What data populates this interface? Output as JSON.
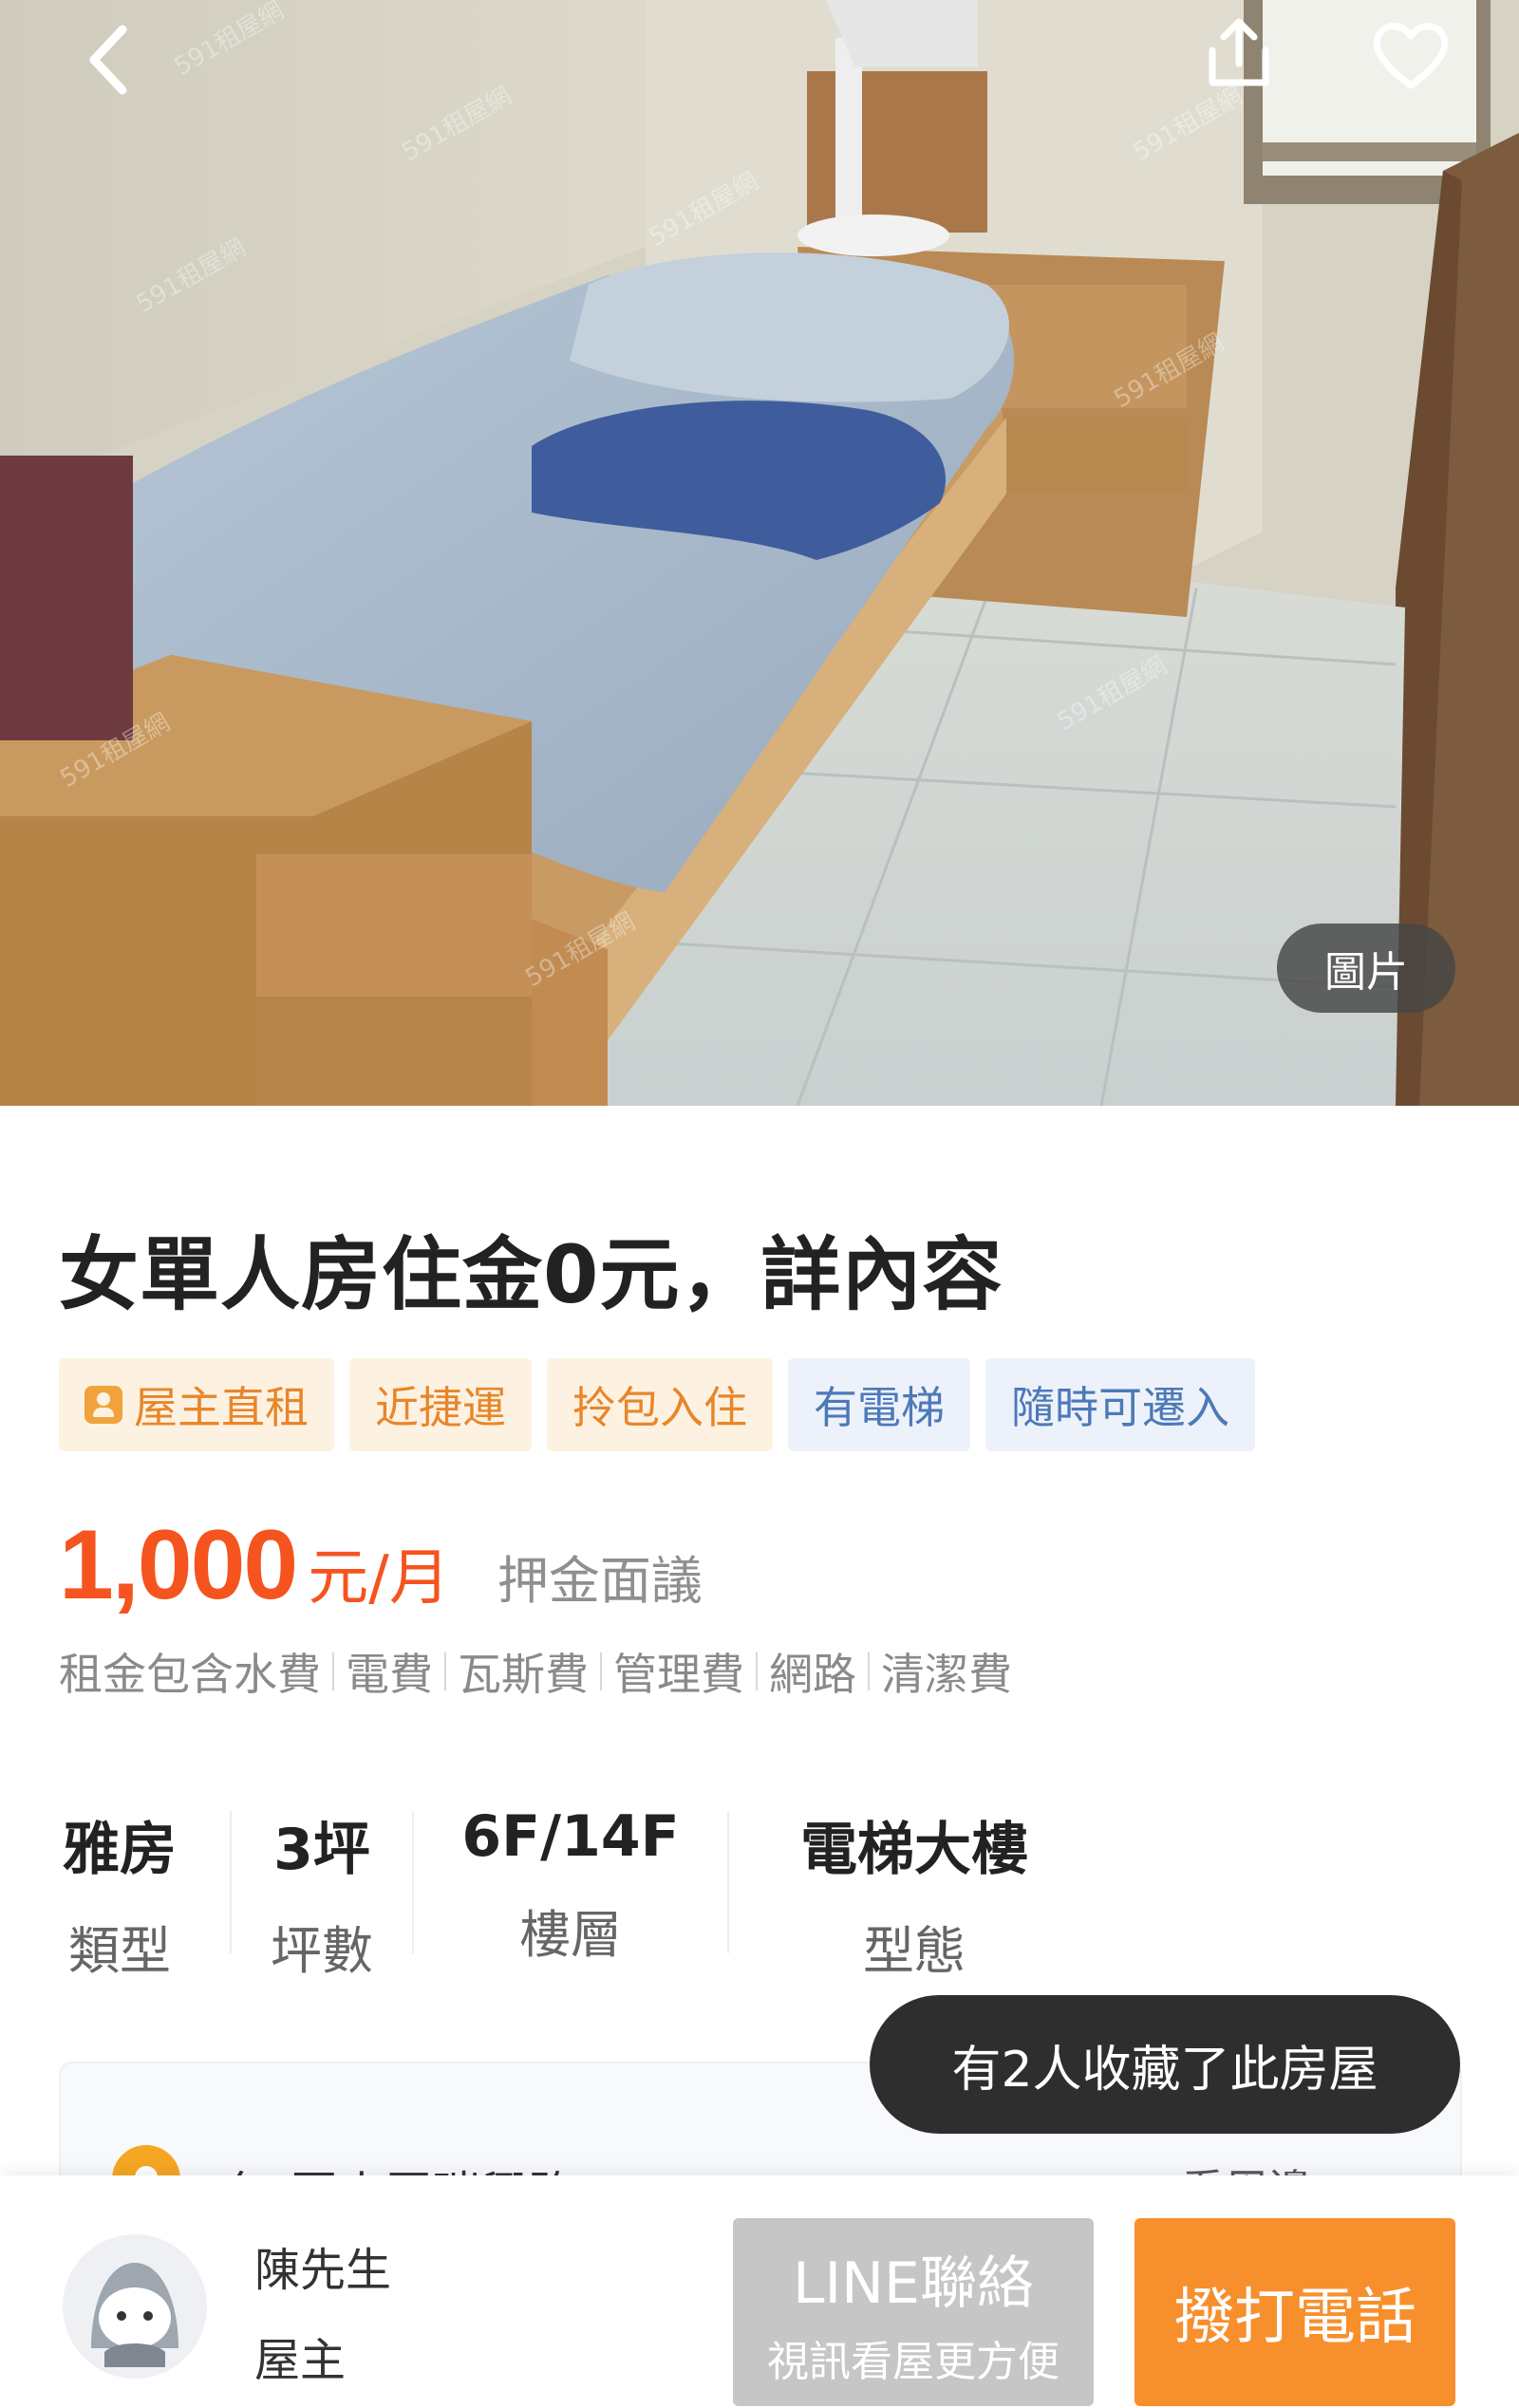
{
  "photo": {
    "badge_label": "圖片",
    "watermark": "591租屋網"
  },
  "header": {
    "back_icon": "chevron-left-icon",
    "share_icon": "share-icon",
    "favorite_icon": "heart-outline-icon"
  },
  "listing": {
    "title": "女單人房住金0元，詳內容",
    "tags": [
      {
        "label": "屋主直租",
        "style": "warm",
        "icon": "owner-icon"
      },
      {
        "label": "近捷運",
        "style": "warm"
      },
      {
        "label": "拎包入住",
        "style": "warm"
      },
      {
        "label": "有電梯",
        "style": "cool"
      },
      {
        "label": "隨時可遷入",
        "style": "cool"
      }
    ],
    "price": {
      "amount": "1,000",
      "unit": "元/月",
      "deposit": "押金面議",
      "color": "#f5541f"
    },
    "includes_prefix": "租金包含",
    "includes": [
      "水費",
      "電費",
      "瓦斯費",
      "管理費",
      "網路",
      "清潔費"
    ],
    "specs": [
      {
        "value": "雅房",
        "label": "類型"
      },
      {
        "value": "3坪",
        "label": "坪數"
      },
      {
        "value": "6F/14F",
        "label": "樓層"
      },
      {
        "value": "電梯大樓",
        "label": "型態"
      }
    ],
    "location": {
      "text": "無 圓山區瑞興路",
      "link": "看周邊"
    }
  },
  "toast": {
    "text": "有2人收藏了此房屋"
  },
  "contact": {
    "name": "陳先生",
    "role": "屋主",
    "line_button": "LINE聯絡",
    "line_sub": "視訊看屋更方便",
    "call_button": "撥打電話",
    "call_color": "#f78f2d"
  }
}
